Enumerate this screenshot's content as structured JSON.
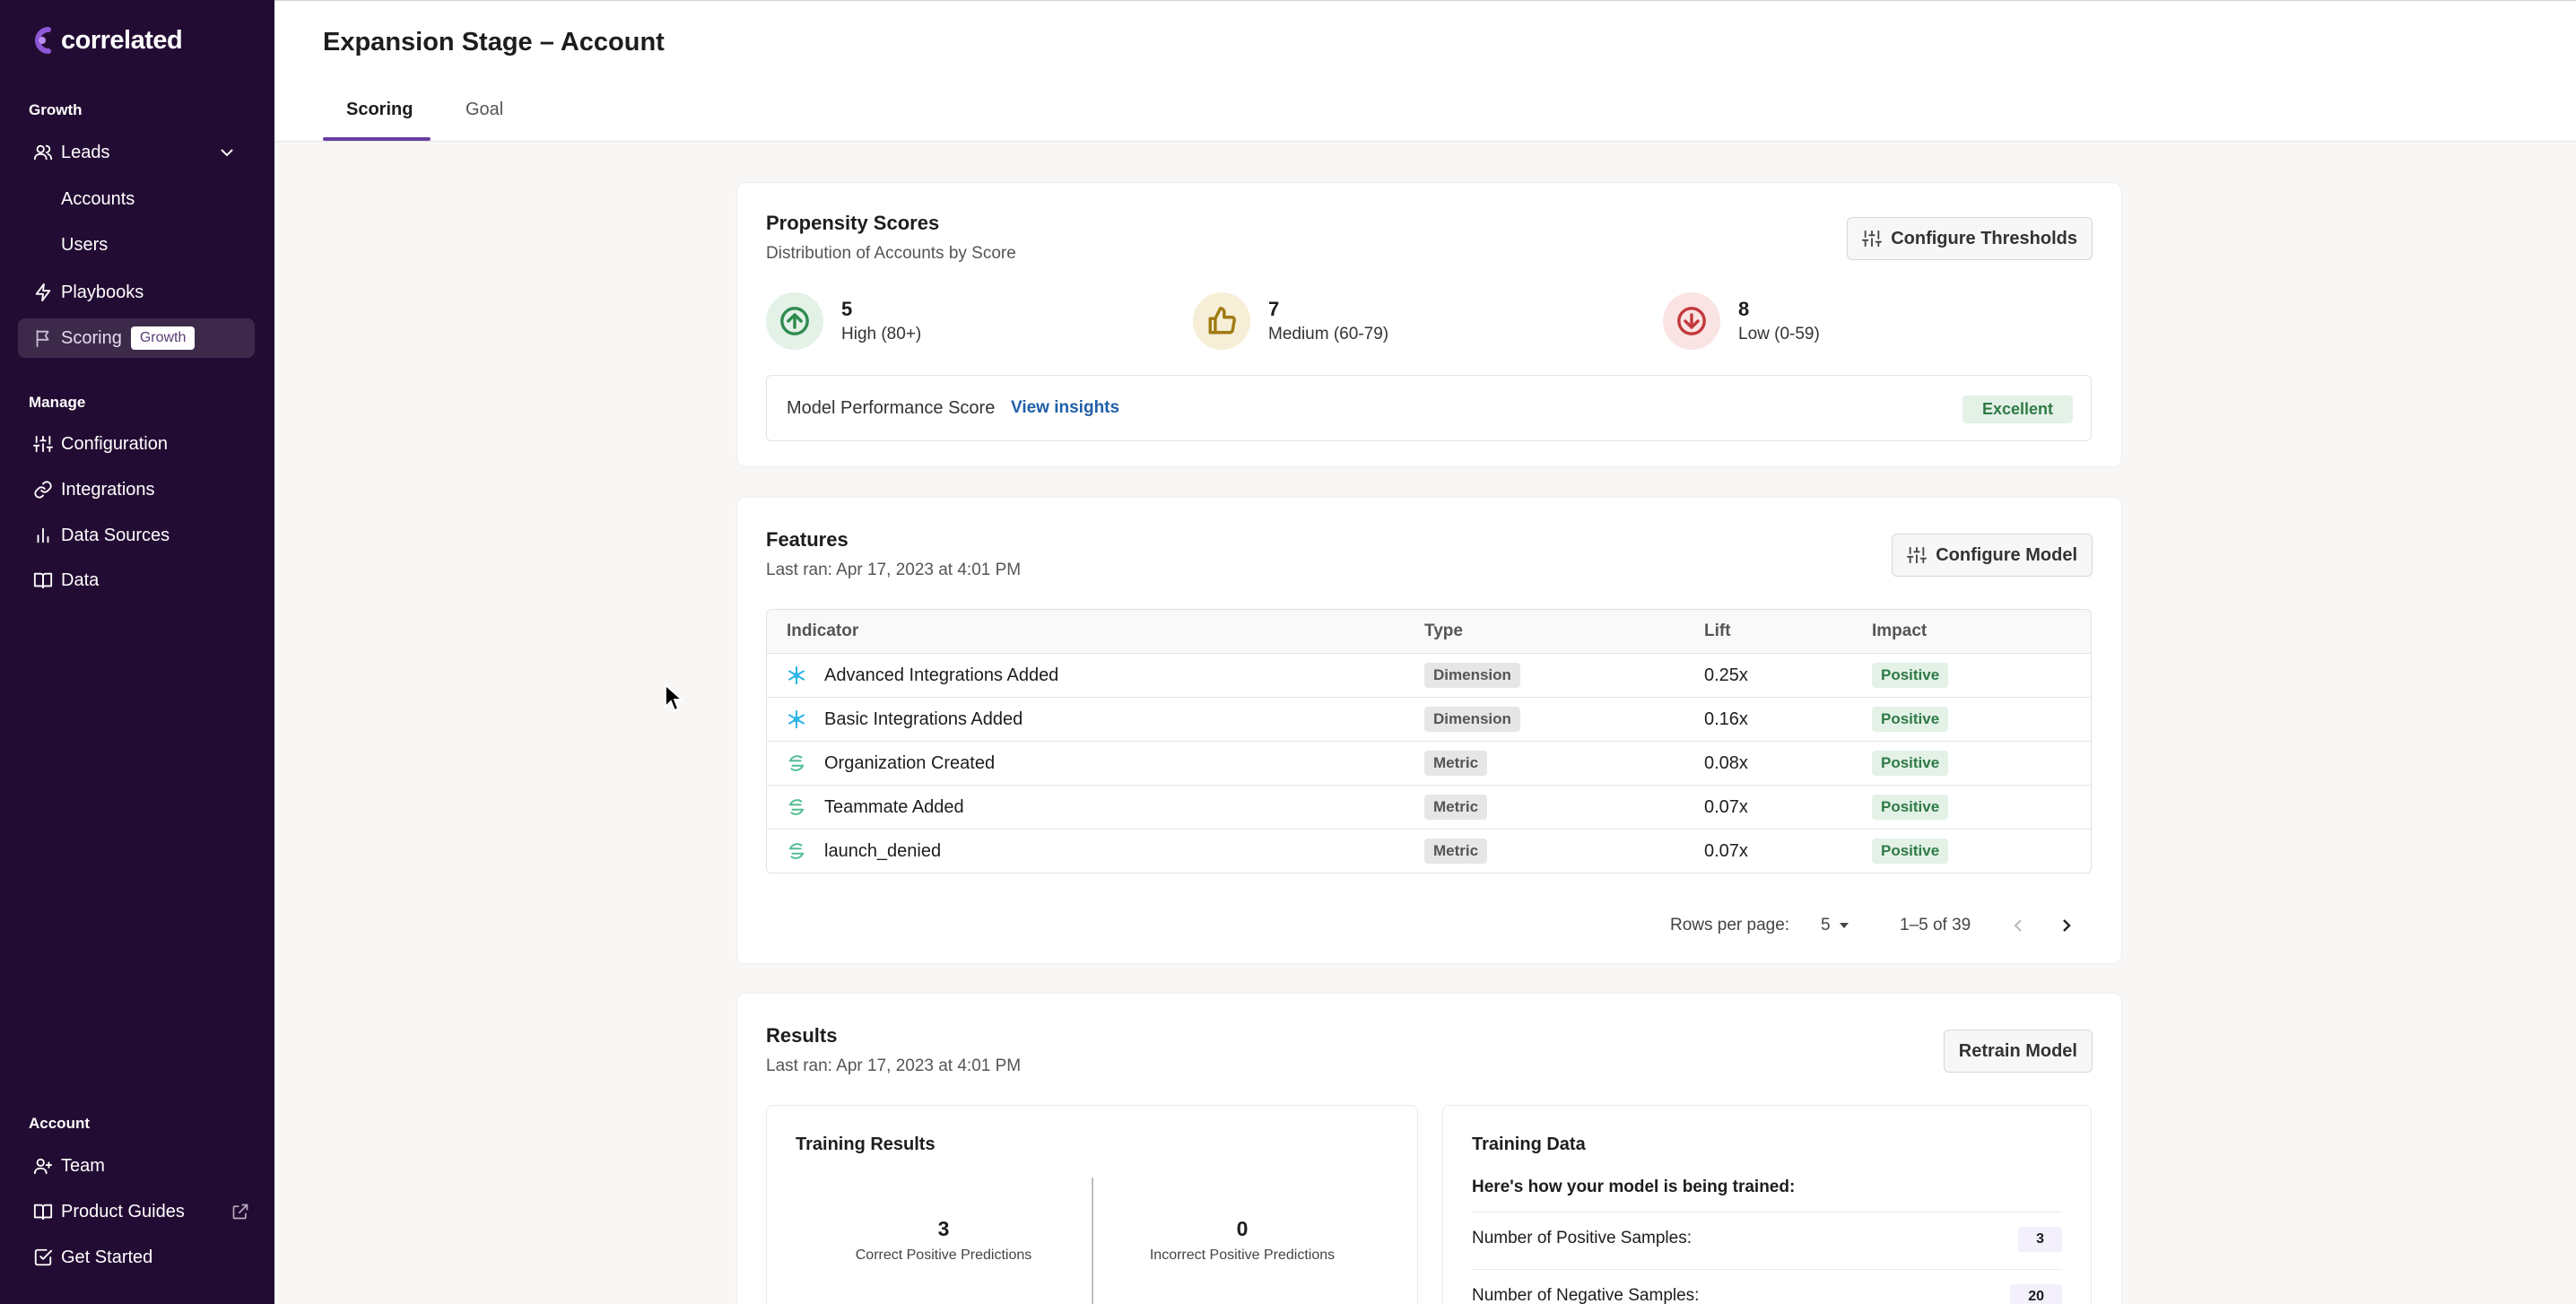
{
  "app": {
    "logo_text": "correlated"
  },
  "sidebar": {
    "growth_label": "Growth",
    "leads": "Leads",
    "accounts": "Accounts",
    "users": "Users",
    "playbooks": "Playbooks",
    "scoring": "Scoring",
    "scoring_badge": "Growth",
    "manage_label": "Manage",
    "configuration": "Configuration",
    "integrations": "Integrations",
    "data_sources": "Data Sources",
    "data": "Data",
    "account_label": "Account",
    "team": "Team",
    "product_guides": "Product Guides",
    "get_started": "Get Started"
  },
  "header": {
    "title": "Expansion Stage – Account",
    "tabs": [
      "Scoring",
      "Goal"
    ]
  },
  "propensity": {
    "title": "Propensity Scores",
    "subtitle": "Distribution of Accounts by Score",
    "configure_label": "Configure Thresholds",
    "scores": [
      {
        "count": "5",
        "label": "High (80+)",
        "color": "#2f8a4f",
        "bg": "#e3f1e7"
      },
      {
        "count": "7",
        "label": "Medium (60-79)",
        "color": "#a07a12",
        "bg": "#f6eed6"
      },
      {
        "count": "8",
        "label": "Low (0-59)",
        "color": "#c2393c",
        "bg": "#fae3e3"
      }
    ],
    "performance_label": "Model Performance Score",
    "view_insights": "View insights",
    "performance_badge": "Excellent"
  },
  "features": {
    "title": "Features",
    "last_ran": "Last ran: Apr 17, 2023 at 4:01 PM",
    "configure_label": "Configure Model",
    "columns": [
      "Indicator",
      "Type",
      "Lift",
      "Impact"
    ],
    "rows": [
      {
        "indicator": "Advanced Integrations Added",
        "icon": "snowflake-icon",
        "type": "Dimension",
        "lift": "0.25x",
        "impact": "Positive"
      },
      {
        "indicator": "Basic Integrations Added",
        "icon": "snowflake-icon",
        "type": "Dimension",
        "lift": "0.16x",
        "impact": "Positive"
      },
      {
        "indicator": "Organization Created",
        "icon": "segment-icon",
        "type": "Metric",
        "lift": "0.08x",
        "impact": "Positive"
      },
      {
        "indicator": "Teammate Added",
        "icon": "segment-icon",
        "type": "Metric",
        "lift": "0.07x",
        "impact": "Positive"
      },
      {
        "indicator": "launch_denied",
        "icon": "segment-icon",
        "type": "Metric",
        "lift": "0.07x",
        "impact": "Positive"
      }
    ],
    "rows_per_page_label": "Rows per page:",
    "rows_per_page": "5",
    "range": "1–5 of 39"
  },
  "results": {
    "title": "Results",
    "last_ran": "Last ran: Apr 17, 2023 at 4:01 PM",
    "retrain_label": "Retrain Model",
    "training_results_title": "Training Results",
    "correct_count": "3",
    "correct_label": "Correct Positive Predictions",
    "incorrect_count": "0",
    "incorrect_label": "Incorrect Positive Predictions",
    "training_data_title": "Training Data",
    "training_data_heading": "Here's how your model is being trained:",
    "positive_samples_label": "Number of Positive Samples:",
    "positive_samples": "3",
    "negative_samples_label": "Number of Negative Samples:",
    "negative_samples": "20"
  }
}
